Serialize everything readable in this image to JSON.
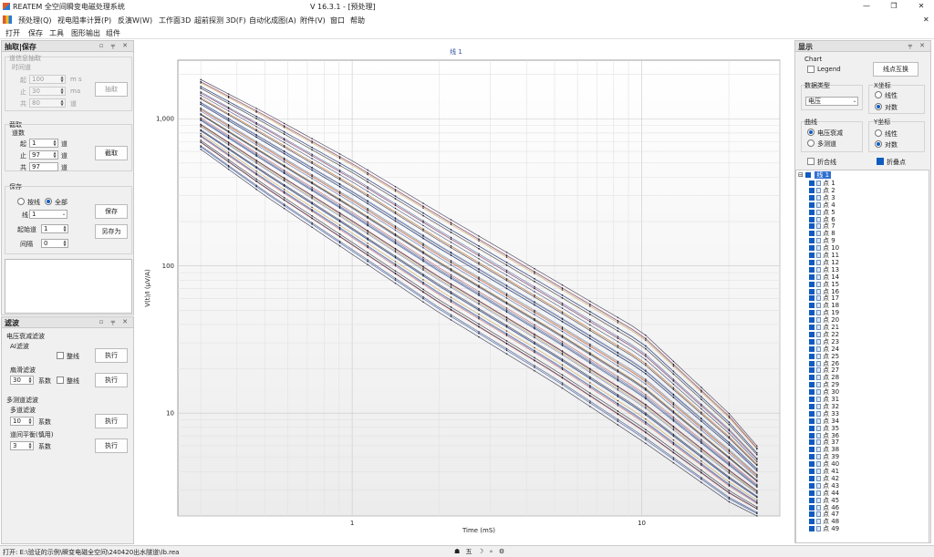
{
  "window": {
    "title": "REATEM 全空间瞬变电磁处理系统",
    "version": "V 16.3.1 - [预处理]",
    "controls": [
      "—",
      "❐",
      "✕"
    ]
  },
  "menu": {
    "items": [
      "预处理(Q)",
      "视电阻率计算(P)",
      "反演W(W)",
      "工作面3D",
      "超前探测 3D(F)",
      "自动化成图(A)",
      "附件(V)",
      "窗口",
      "帮助"
    ]
  },
  "toolbar": {
    "items": [
      "打开",
      "保存",
      "工具",
      "图形输出",
      "组件"
    ]
  },
  "extract_panel": {
    "title": "抽取|保存",
    "buttons": "▫ ╤ ✕",
    "time_extract": {
      "group": "道信息抽取",
      "sub": "时间道",
      "start_label": "起",
      "start_value": "100",
      "start_unit": "m s",
      "stop_label": "止",
      "stop_value": "30",
      "stop_unit": "ma",
      "total_label": "共",
      "total_value": "80",
      "total_unit": "道",
      "button": "抽取"
    },
    "cut": {
      "group": "截取",
      "sub": "道数",
      "start_label": "起",
      "start_value": "1",
      "start_unit": "道",
      "stop_label": "止",
      "stop_value": "97",
      "stop_unit": "道",
      "total_label": "共",
      "total_value": "97",
      "total_unit": "道",
      "button": "截取"
    },
    "save": {
      "group": "保存",
      "by_line": "按线",
      "all": "全部",
      "line_label": "线",
      "line_value": "1",
      "start_label": "起始道",
      "start_value": "1",
      "interval_label": "间隔",
      "interval_value": "0",
      "save_button": "保存",
      "save_as_button": "另存为"
    }
  },
  "filter_panel": {
    "title": "滤波",
    "buttons": "▫ ╤ ✕",
    "decay": "电压衰减滤波",
    "ai": "AI滤波",
    "whole_line": "整线",
    "run": "执行",
    "sliding": "扇滑滤波",
    "sliding_value": "30",
    "coef": "系数",
    "multi_measure": "多测道滤波",
    "multi_channel": "多道滤波",
    "multi_value": "10",
    "balance": "道间平衡(慎用)",
    "balance_value": "3"
  },
  "display_panel": {
    "title": "显示",
    "buttons": "╤ ✕",
    "chart_label": "Chart",
    "legend": "Legend",
    "swap_button": "线点互换",
    "data_type": "数据类型",
    "data_type_value": "电压",
    "x_axis": "X坐标",
    "linear": "线性",
    "log": "对数",
    "curve": "曲线",
    "voltage_decay": "电压衰减",
    "multi_channel": "多测道",
    "y_axis": "Y坐标",
    "polyline": "折合线",
    "fold_point": "折叠点",
    "tree_root": "线 1",
    "tree_prefix": "点",
    "points": [
      "1",
      "2",
      "3",
      "4",
      "5",
      "6",
      "7",
      "8",
      "9",
      "10",
      "11",
      "12",
      "13",
      "14",
      "15",
      "16",
      "17",
      "18",
      "19",
      "20",
      "21",
      "22",
      "23",
      "24",
      "25",
      "26",
      "27",
      "28",
      "29",
      "30",
      "31",
      "32",
      "33",
      "34",
      "35",
      "36",
      "37",
      "38",
      "39",
      "40",
      "41",
      "42",
      "43",
      "44",
      "45",
      "46",
      "47",
      "48",
      "49"
    ]
  },
  "status": {
    "text": "打开: E:\\验证的示例\\瞬变电磁全空间\\240420出水隧道\\lb.rea",
    "tray": "☗ 五 ☽ ∘ ⚙"
  },
  "chart_data": {
    "type": "line",
    "title": "线 1",
    "xlabel": "Time (mS)",
    "ylabel": "V(t)/I (μV/A)",
    "x_scale": "log",
    "y_scale": "log",
    "xlim": [
      0.25,
      30
    ],
    "ylim": [
      2,
      2500
    ],
    "x_ticks": [
      1,
      10
    ],
    "x_tick_labels": [
      "1",
      "10"
    ],
    "y_ticks": [
      10,
      100,
      1000
    ],
    "y_tick_labels": [
      "10",
      "100",
      "1,000"
    ],
    "grid": true,
    "legend": "none",
    "series_count": 49,
    "series_envelope": {
      "x": [
        0.3,
        0.5,
        1,
        2,
        5,
        10,
        20,
        25
      ],
      "upper": [
        1850,
        1100,
        520,
        230,
        80,
        36,
        10,
        6
      ],
      "lower": [
        620,
        300,
        120,
        48,
        16,
        6.5,
        2.5,
        2
      ]
    },
    "line_colors": [
      "#1a1a3a",
      "#2c3e6b",
      "#3a5ba0",
      "#5a78b8",
      "#b9474f",
      "#c89a3a"
    ]
  }
}
